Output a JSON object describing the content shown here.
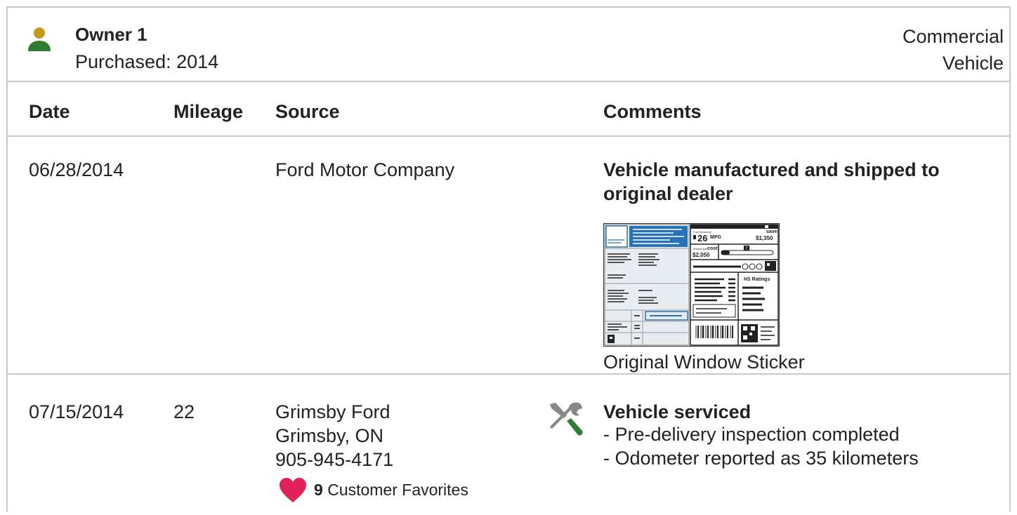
{
  "owner": {
    "title": "Owner 1",
    "purchased": "Purchased: 2014",
    "type_line1": "Commercial",
    "type_line2": "Vehicle",
    "icon": "person-icon",
    "icon_colors": {
      "head": "#C49A1C",
      "body": "#2E7D32"
    }
  },
  "table": {
    "headers": [
      "Date",
      "Mileage",
      "Source",
      "Comments"
    ]
  },
  "records": [
    {
      "date": "06/28/2014",
      "mileage": "",
      "source_name": "Ford Motor Company",
      "comment_title": "Vehicle manufactured and shipped to original dealer",
      "attachment_caption": "Original Window Sticker",
      "sticker": {
        "mpg": "26",
        "mpg_unit": "MPG",
        "save_label": "save",
        "save_value": "$1,350",
        "cost_label": "cost",
        "cost_value": "$2,050",
        "rating": "7",
        "ratings_label": "HS Ratings"
      }
    },
    {
      "date": "07/15/2014",
      "mileage": "22",
      "source_name": "Grimsby Ford",
      "source_city": "Grimsby, ON",
      "source_phone": "905-945-4171",
      "favorites_count": "9",
      "favorites_label": "Customer Favorites",
      "service_icon": "wrench-screwdriver-icon",
      "favorites_icon": "heart-icon",
      "heart_color": "#E0215A",
      "comment_title": "Vehicle serviced",
      "comment_items": [
        "Pre-delivery inspection completed",
        "Odometer reported as 35 kilometers"
      ]
    }
  ]
}
